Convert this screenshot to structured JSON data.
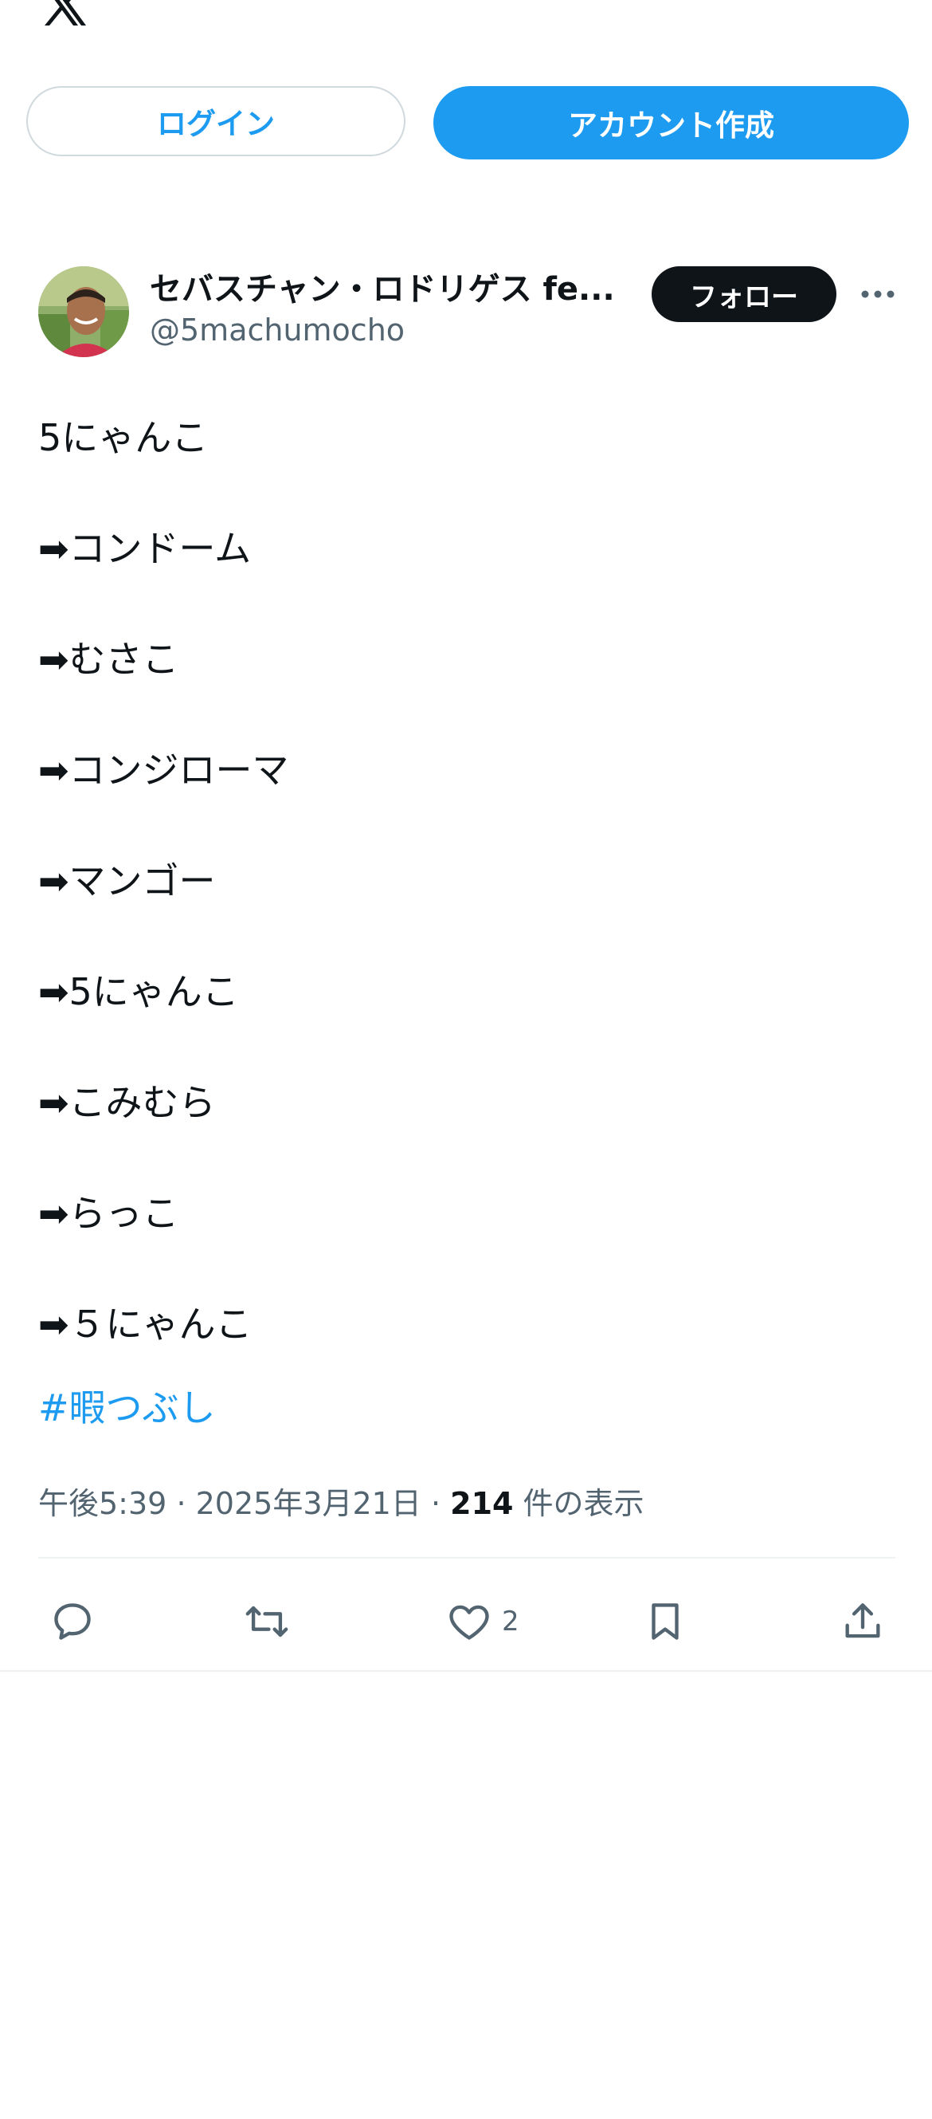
{
  "header": {
    "logo_icon": "x-logo-icon",
    "more_icon": "more-dots-icon"
  },
  "auth": {
    "login_label": "ログイン",
    "signup_label": "アカウント作成"
  },
  "tweet": {
    "author_name": "セバスチャン・ロドリゲス fe...",
    "author_handle": "@5machumocho",
    "follow_label": "フォロー",
    "lines": [
      "5にゃんこ",
      "➡︎コンドーム",
      "➡︎むさこ",
      "➡︎コンジローマ",
      "➡︎マンゴー",
      "➡︎5にゃんこ",
      "➡︎こみむら",
      "➡︎らっこ",
      "➡︎５にゃんこ"
    ],
    "hashtag": "#暇つぶし",
    "time": "午後5:39",
    "date": "2025年3月21日",
    "views_count": "214",
    "views_label": "件の表示",
    "like_count": "2"
  },
  "colors": {
    "accent": "#1d9bf0",
    "text": "#0f1419",
    "muted": "#536471",
    "border": "#cfd9de"
  }
}
